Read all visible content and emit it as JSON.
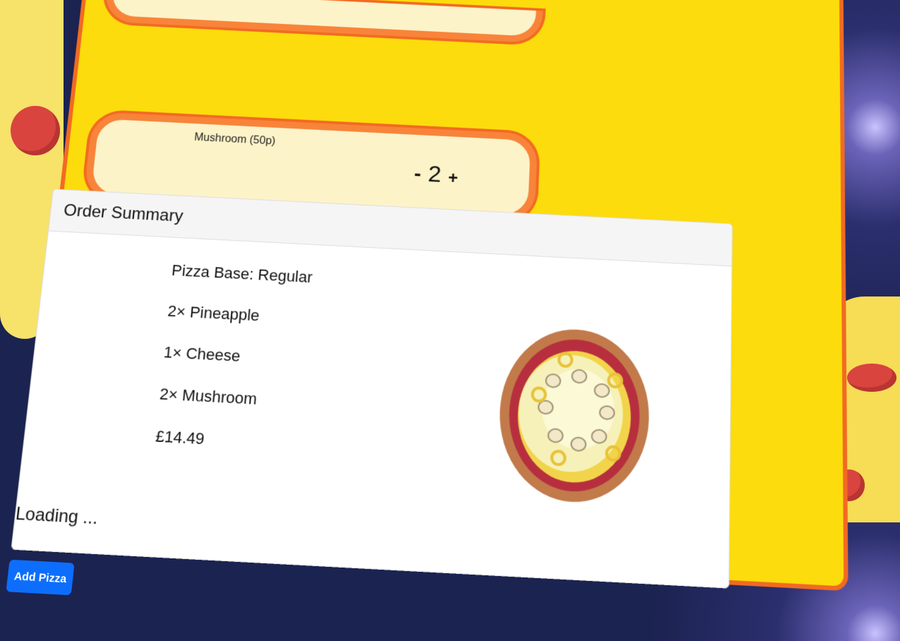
{
  "toppings": {
    "mushroom": {
      "label": "Mushroom (50p)",
      "minus": "-",
      "quantity": "2",
      "plus": "+"
    }
  },
  "summary": {
    "title": "Order Summary",
    "lines": [
      "Pizza Base: Regular",
      "2× Pineapple",
      "1× Cheese",
      "2× Mushroom",
      "£14.49"
    ],
    "loading": "Loading ..."
  },
  "actions": {
    "add_pizza": "Add Pizza"
  },
  "colors": {
    "panel": "#fcdc0c",
    "border": "#f26a22",
    "card": "#fdf3c8",
    "button": "#0d6efd"
  },
  "icons": {
    "pizza": "pizza-preview-image"
  }
}
